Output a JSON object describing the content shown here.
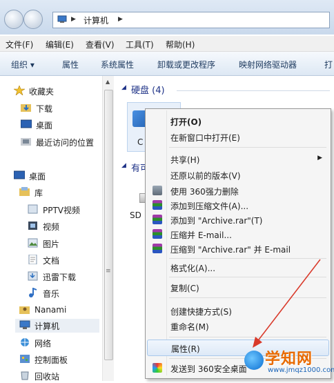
{
  "address": {
    "location": "计算机"
  },
  "menubar": [
    "文件(F)",
    "编辑(E)",
    "查看(V)",
    "工具(T)",
    "帮助(H)"
  ],
  "toolbar": [
    "组织 ▾",
    "属性",
    "系统属性",
    "卸载或更改程序",
    "映射网络驱动器",
    "打"
  ],
  "nav": {
    "favorites_title": "收藏夹",
    "favorites": [
      "下载",
      "桌面",
      "最近访问的位置"
    ],
    "desktop": "桌面",
    "library": "库",
    "libraries": [
      "PPTV视频",
      "视频",
      "图片",
      "文档",
      "迅雷下载",
      "音乐"
    ],
    "user": "Nanami",
    "computer": "计算机",
    "network": "网络",
    "control_panel": "控制面板",
    "recycle": "回收站"
  },
  "content": {
    "hdd_group": "硬盘 (4)",
    "removable_group": "有可",
    "drive_label": "C",
    "sd_label": "SD"
  },
  "context_menu": {
    "items": [
      {
        "label": "打开(O)",
        "bold": true
      },
      {
        "label": "在新窗口中打开(E)"
      },
      {
        "label": "共享(H)",
        "submenu": true
      },
      {
        "label": "还原以前的版本(V)"
      },
      {
        "label": "使用 360强力删除",
        "icon": "trash-icon"
      },
      {
        "label": "添加到压缩文件(A)...",
        "icon": "winrar-icon"
      },
      {
        "label": "添加到 \"Archive.rar\"(T)",
        "icon": "winrar-icon"
      },
      {
        "label": "压缩并 E-mail...",
        "icon": "winrar-icon"
      },
      {
        "label": "压缩到 \"Archive.rar\" 并 E-mail",
        "icon": "winrar-icon"
      },
      {
        "label": "格式化(A)..."
      },
      {
        "label": "复制(C)"
      },
      {
        "label": "创建快捷方式(S)"
      },
      {
        "label": "重命名(M)"
      },
      {
        "label": "属性(R)",
        "highlighted": true
      },
      {
        "label": "发送到 360安全桌面",
        "icon": "360-icon"
      }
    ]
  },
  "watermark": {
    "name": "学知网",
    "url": "www.jmqz1000.com"
  },
  "colors": {
    "accent": "#1e3287",
    "highlight": "#dde9f7",
    "arrow": "#d93a2b"
  }
}
